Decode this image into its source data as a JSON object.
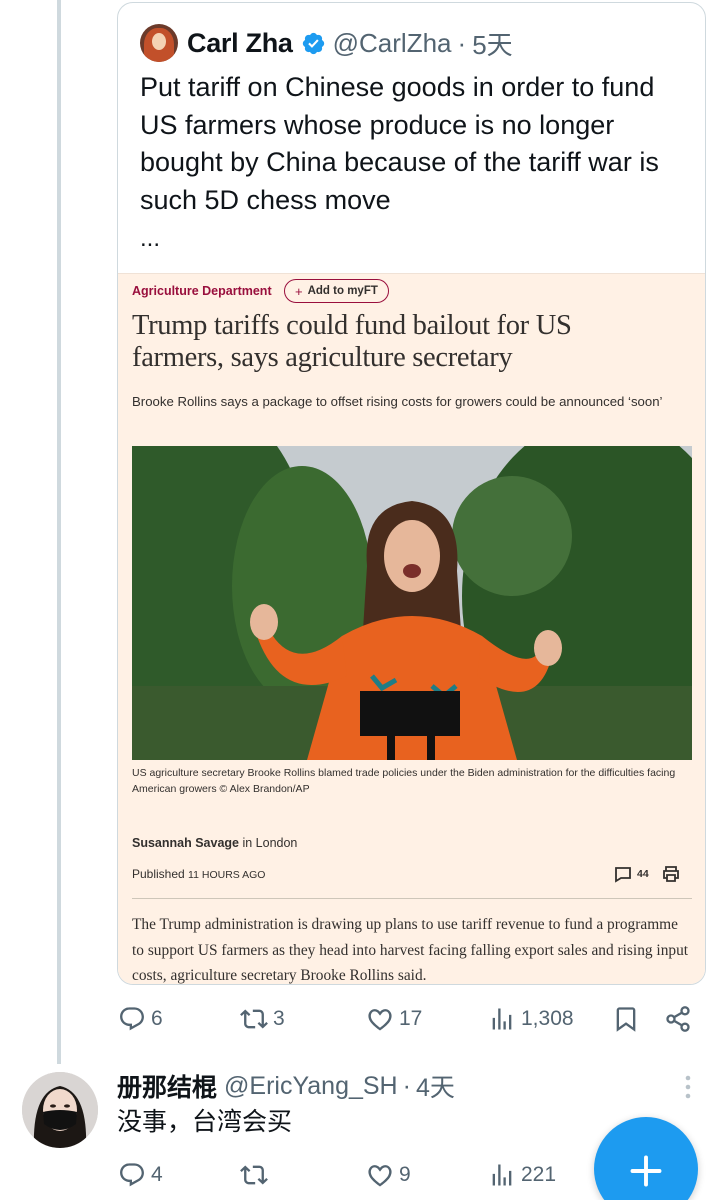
{
  "quoted_tweet": {
    "author_name": "Carl Zha",
    "handle": "@CarlZha",
    "dot": "·",
    "time": "5天",
    "text": "Put tariff on Chinese goods in order to fund US farmers whose produce is no longer bought by China because of the tariff war is such 5D chess move",
    "more": "...",
    "article": {
      "tag": "Agriculture Department",
      "myft_label": "Add to myFT",
      "headline": "Trump tariffs could fund bailout for US farmers, says agriculture secretary",
      "standfirst": "Brooke Rollins says a package to offset rising costs for growers could be announced ‘soon’",
      "caption": "US agriculture secretary Brooke Rollins blamed trade policies under the Biden administration for the difficulties facing American growers © Alex Brandon/AP",
      "author": "Susannah Savage",
      "author_location": " in London",
      "published_label": "Published ",
      "published_time": "11 HOURS AGO",
      "comment_count": "44",
      "body": "The Trump administration is drawing up plans to use tariff revenue to fund a programme to support US farmers as they head into harvest facing falling export sales and rising input costs, agriculture secretary Brooke Rollins said."
    }
  },
  "main_actions": {
    "replies": "6",
    "reposts": "3",
    "likes": "17",
    "views": "1,308"
  },
  "reply": {
    "author_name": "册那结棍",
    "handle": "@EricYang_SH",
    "dot": "·",
    "time": "4天",
    "text": "没事，台湾会买",
    "actions": {
      "replies": "4",
      "likes": "9",
      "views": "221"
    }
  },
  "colors": {
    "accent": "#1d9bf0",
    "muted_text": "#536471",
    "ft_background": "#fff1e5",
    "ft_claret": "#990f3d"
  },
  "icons": [
    "verified-badge-icon",
    "reply-icon",
    "repost-icon",
    "like-icon",
    "views-icon",
    "bookmark-icon",
    "share-icon",
    "more-options-icon",
    "compose-plus-icon",
    "comment-icon",
    "print-icon"
  ]
}
